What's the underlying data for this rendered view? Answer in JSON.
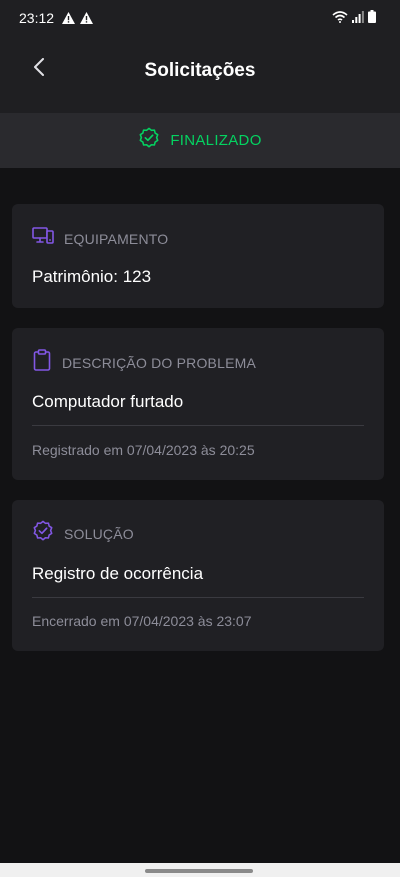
{
  "statusbar": {
    "time": "23:12",
    "icons": [
      "warning-icon",
      "warning-icon",
      "wifi-icon",
      "signal-icon",
      "battery-icon"
    ]
  },
  "header": {
    "title": "Solicitações",
    "back_icon": "chevron-left-icon"
  },
  "status": {
    "label": "FINALIZADO",
    "icon": "check-badge-icon",
    "color": "#04d361"
  },
  "cards": {
    "equipment": {
      "heading": "EQUIPAMENTO",
      "icon": "desktop-icon",
      "value": "Patrimônio: 123"
    },
    "problem": {
      "heading": "DESCRIÇÃO DO PROBLEMA",
      "icon": "clipboard-icon",
      "value": "Computador furtado",
      "footer": "Registrado em 07/04/2023 às 20:25"
    },
    "solution": {
      "heading": "SOLUÇÃO",
      "icon": "check-badge-icon",
      "value": "Registro de ocorrência",
      "footer": "Encerrado em 07/04/2023 às 23:07"
    }
  },
  "colors": {
    "accent": "#8257e5",
    "success": "#04d361",
    "background": "#121214",
    "card": "#202024"
  }
}
